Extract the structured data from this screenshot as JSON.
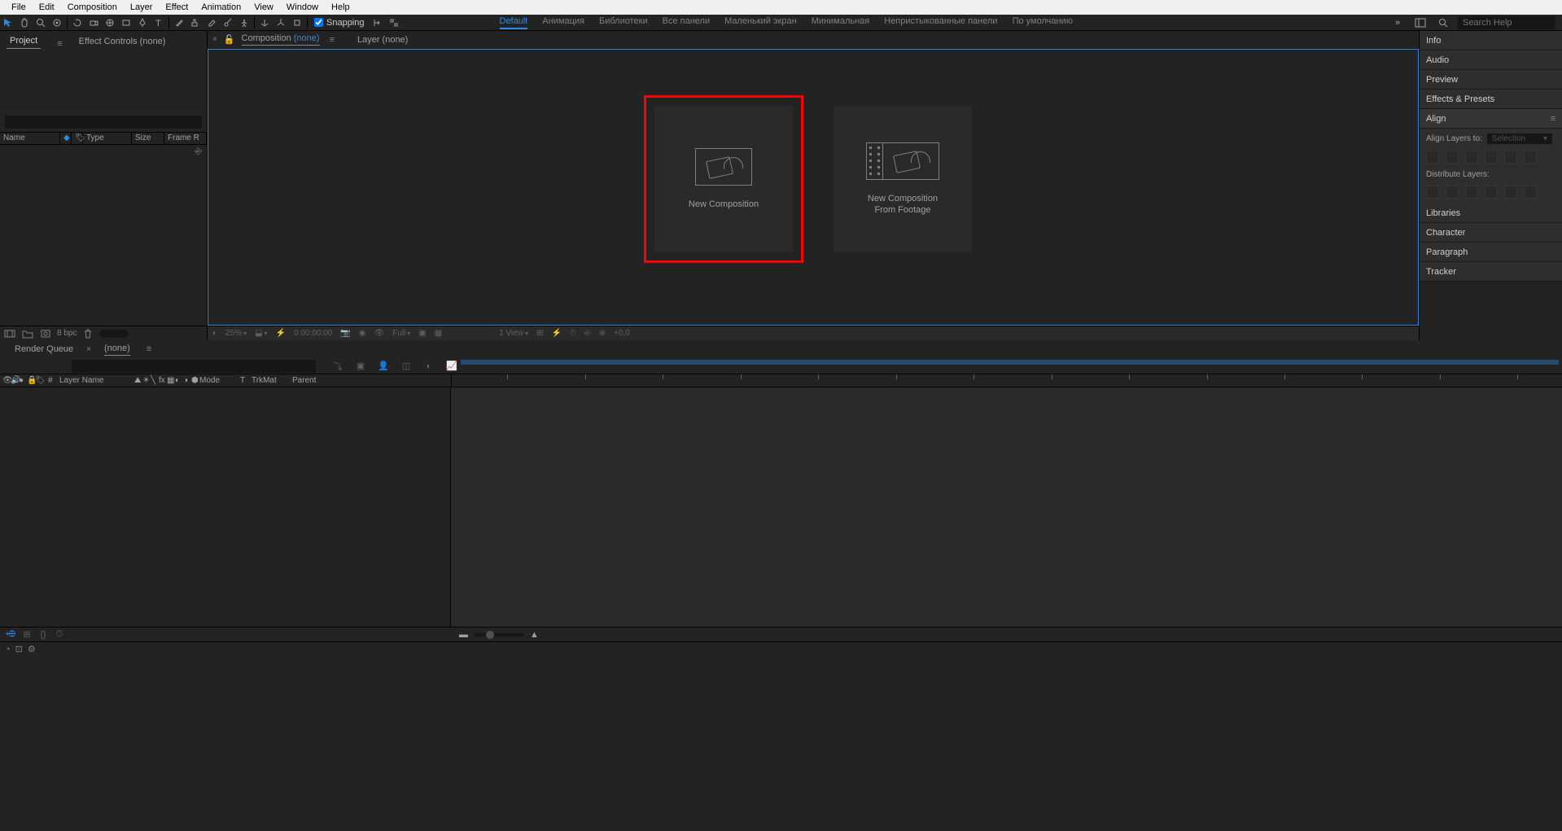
{
  "menu": [
    "File",
    "Edit",
    "Composition",
    "Layer",
    "Effect",
    "Animation",
    "View",
    "Window",
    "Help"
  ],
  "toolbar": {
    "snapping_label": "Snapping"
  },
  "workspaces": {
    "items": [
      "Default",
      "Анимация",
      "Библиотеки",
      "Все панели",
      "Маленький экран",
      "Минимальная",
      "Непристыкованные панели",
      "По умолчанию"
    ],
    "active": 0
  },
  "search": {
    "placeholder": "Search Help"
  },
  "project_panel": {
    "tabs": [
      "Project",
      "Effect Controls (none)"
    ],
    "columns": [
      "Name",
      "Type",
      "Size",
      "Frame R"
    ],
    "bpc": "8 bpc"
  },
  "comp_panel": {
    "tab_label": "Composition",
    "tab_none": "(none)",
    "layer_tab": "Layer (none)",
    "card1": "New Composition",
    "card2_l1": "New Composition",
    "card2_l2": "From Footage",
    "footer": {
      "zoom": "25%",
      "time": "0:00:00:00",
      "res": "Full",
      "view": "1 View",
      "exposure": "+0,0"
    }
  },
  "right_panels": {
    "items": [
      "Info",
      "Audio",
      "Preview",
      "Effects & Presets",
      "Align",
      "Libraries",
      "Character",
      "Paragraph",
      "Tracker"
    ],
    "align": {
      "align_label": "Align Layers to:",
      "align_value": "Selection",
      "distribute_label": "Distribute Layers:"
    }
  },
  "timeline": {
    "tabs": [
      "Render Queue",
      "(none)"
    ],
    "columns_left": [
      "#",
      "Layer Name",
      "Mode",
      "T",
      "TrkMat",
      "Parent"
    ]
  }
}
